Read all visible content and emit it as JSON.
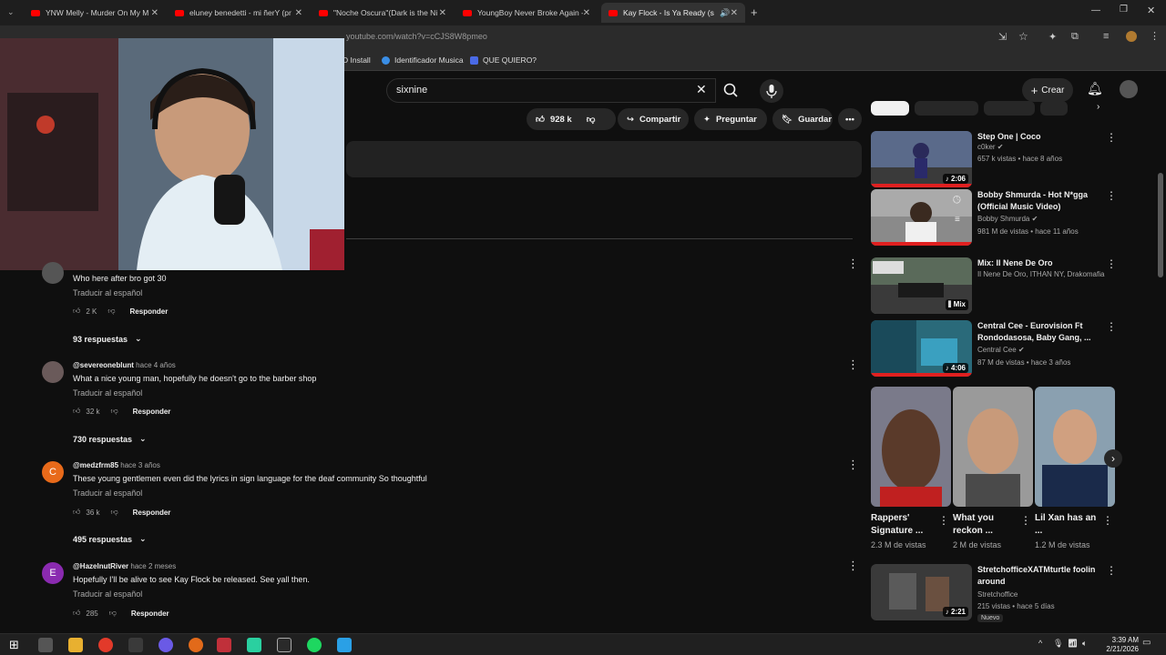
{
  "tabs": [
    {
      "title": "YNW Melly - Murder On My M"
    },
    {
      "title": "eluney benedetti - mi ñerY (pr"
    },
    {
      "title": "\"Noche Oscura\"(Dark is the Ni"
    },
    {
      "title": "YoungBoy Never Broke Again -"
    },
    {
      "title": "Kay Flock - Is Ya Ready (sho"
    }
  ],
  "url": "youtube.com/watch?v=cCJS8W8pmeo",
  "bookmarks": [
    {
      "label": "D Install"
    },
    {
      "label": "Identificador Musica"
    },
    {
      "label": "QUE QUIERO?"
    }
  ],
  "header": {
    "search_value": "sixnine",
    "create_label": "Crear"
  },
  "actions": {
    "likes": "928 k",
    "share": "Compartir",
    "ask": "Preguntar",
    "save": "Guardar"
  },
  "comments": [
    {
      "handle": "",
      "time": "",
      "text": "Who here after bro got 30",
      "translate": "Traducir al español",
      "likes": "2 K",
      "reply": "Responder",
      "replies": "93 respuestas",
      "initial": ""
    },
    {
      "handle": "@severeoneblunt",
      "time": "hace 4 años",
      "text": "What a nice young man, hopefully he doesn't go to the barber shop",
      "translate": "Traducir al español",
      "likes": "32 k",
      "reply": "Responder",
      "replies": "730 respuestas",
      "initial": ""
    },
    {
      "handle": "@medzfrm85",
      "time": "hace 3 años",
      "text": "These young gentlemen even did the lyrics in sign language for the deaf community So thoughtful",
      "translate": "Traducir al español",
      "likes": "36 k",
      "reply": "Responder",
      "replies": "495 respuestas",
      "initial": "C"
    },
    {
      "handle": "@HazelnutRiver",
      "time": "hace 2 meses",
      "text": "Hopefully I'll be alive to see Kay Flock be released. See yall then.",
      "translate": "Traducir al español",
      "likes": "285",
      "reply": "Responder",
      "replies": "",
      "initial": "E"
    }
  ],
  "sidebar": {
    "videos": [
      {
        "title": "Step One | Coco",
        "channel": "c0ker",
        "meta": "657 k vistas • hace 8 años",
        "duration": "2:06",
        "thumb_color": "#3a4a6a"
      },
      {
        "title": "Bobby Shmurda - Hot N*gga (Official Music Video)",
        "channel": "Bobby Shmurda",
        "meta": "981 M de vistas • hace 11 años",
        "duration": "",
        "thumb_color": "#6a5a4a"
      },
      {
        "title": "Mix: Il Nene De Oro",
        "channel": "Il Nene De Oro, ITHAN NY, Drakomafia y ...",
        "meta": "",
        "duration": "Mix",
        "thumb_color": "#4a5a4a"
      },
      {
        "title": "Central Cee - Eurovision Ft Rondodasosa, Baby Gang, ...",
        "channel": "Central Cee",
        "meta": "87 M de vistas • hace 3 años",
        "duration": "4:06",
        "thumb_color": "#2a6a7a"
      }
    ],
    "shorts": [
      {
        "title": "Rappers' Signature ...",
        "views": "2.3 M de vistas",
        "thumb_color": "#5a4a3a"
      },
      {
        "title": "What you reckon ...",
        "views": "2 M de vistas",
        "thumb_color": "#7a6a5a"
      },
      {
        "title": "Lil Xan has an ...",
        "views": "1.2 M de vistas",
        "thumb_color": "#3a4a6a"
      }
    ],
    "last_video": {
      "title": "StretchofficeXATMturtle foolin around",
      "channel": "Stretchoffice",
      "meta": "215 vistas • hace 5 días",
      "duration": "2:21",
      "badge": "Nuevo",
      "thumb_color": "#3a3a3a"
    }
  },
  "clock": {
    "time": "3:39 AM",
    "date": "2/21/2026"
  }
}
